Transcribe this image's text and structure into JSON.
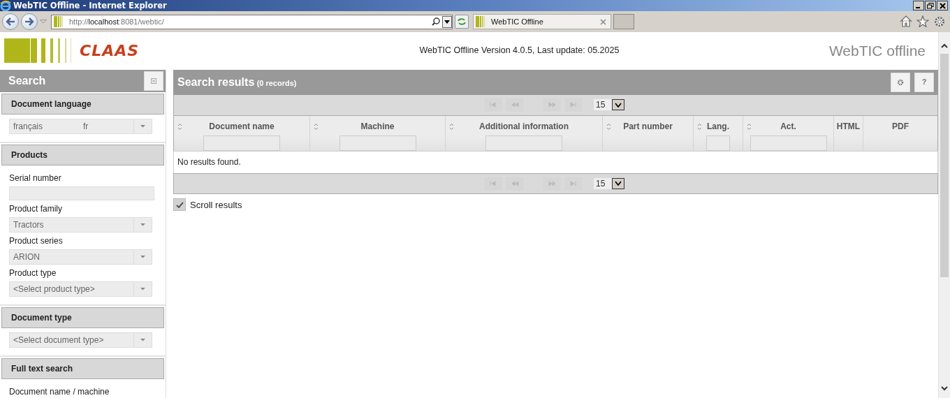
{
  "window": {
    "title": "WebTIC Offline - Internet Explorer"
  },
  "browser": {
    "url": {
      "scheme": "http://",
      "host": "localhost",
      "rest": ":8081/webtic/"
    },
    "tab": {
      "title": "WebTIC Offline"
    }
  },
  "header": {
    "brand": "CLAAS",
    "version_text": "WebTIC Offline Version 4.0.5",
    "last_update_label": ", Last update:",
    "last_update": "05.2025",
    "product_name": "WebTIC offline"
  },
  "sidebar": {
    "title": "Search",
    "sections": [
      {
        "title": "Document language",
        "fields": [
          {
            "kind": "select",
            "value": "français",
            "suffix": "fr"
          }
        ]
      },
      {
        "title": "Products",
        "fields": [
          {
            "kind": "text",
            "label": "Serial number"
          },
          {
            "kind": "select",
            "label": "Product family",
            "value": "Tractors"
          },
          {
            "kind": "select",
            "label": "Product series",
            "value": "ARION"
          },
          {
            "kind": "select",
            "label": "Product type",
            "value": "<Select product type>"
          }
        ]
      },
      {
        "title": "Document type",
        "fields": [
          {
            "kind": "select",
            "value": "<Select document type>"
          }
        ]
      },
      {
        "title": "Full text search",
        "fields": [
          {
            "kind": "label",
            "label": "Document name / machine"
          }
        ]
      }
    ]
  },
  "results": {
    "title": "Search results",
    "count": "(0 records)",
    "help": "?",
    "pager_top": {
      "page_size": "15"
    },
    "pager_bottom": {
      "page_size": "15"
    },
    "columns": [
      {
        "label": "Document name",
        "sortable": true,
        "filter": true
      },
      {
        "label": "Machine",
        "sortable": true,
        "filter": true
      },
      {
        "label": "Additional information",
        "sortable": true,
        "filter": true
      },
      {
        "label": "Part number",
        "sortable": true,
        "filter": false
      },
      {
        "label": "Lang.",
        "sortable": true,
        "filter": true
      },
      {
        "label": "Act.",
        "sortable": true,
        "filter": true
      },
      {
        "label": "HTML",
        "sortable": false,
        "filter": false
      },
      {
        "label": "PDF",
        "sortable": false,
        "filter": false
      }
    ],
    "empty_message": "No results found.",
    "scroll_results": {
      "label": "Scroll results",
      "checked": true
    }
  }
}
